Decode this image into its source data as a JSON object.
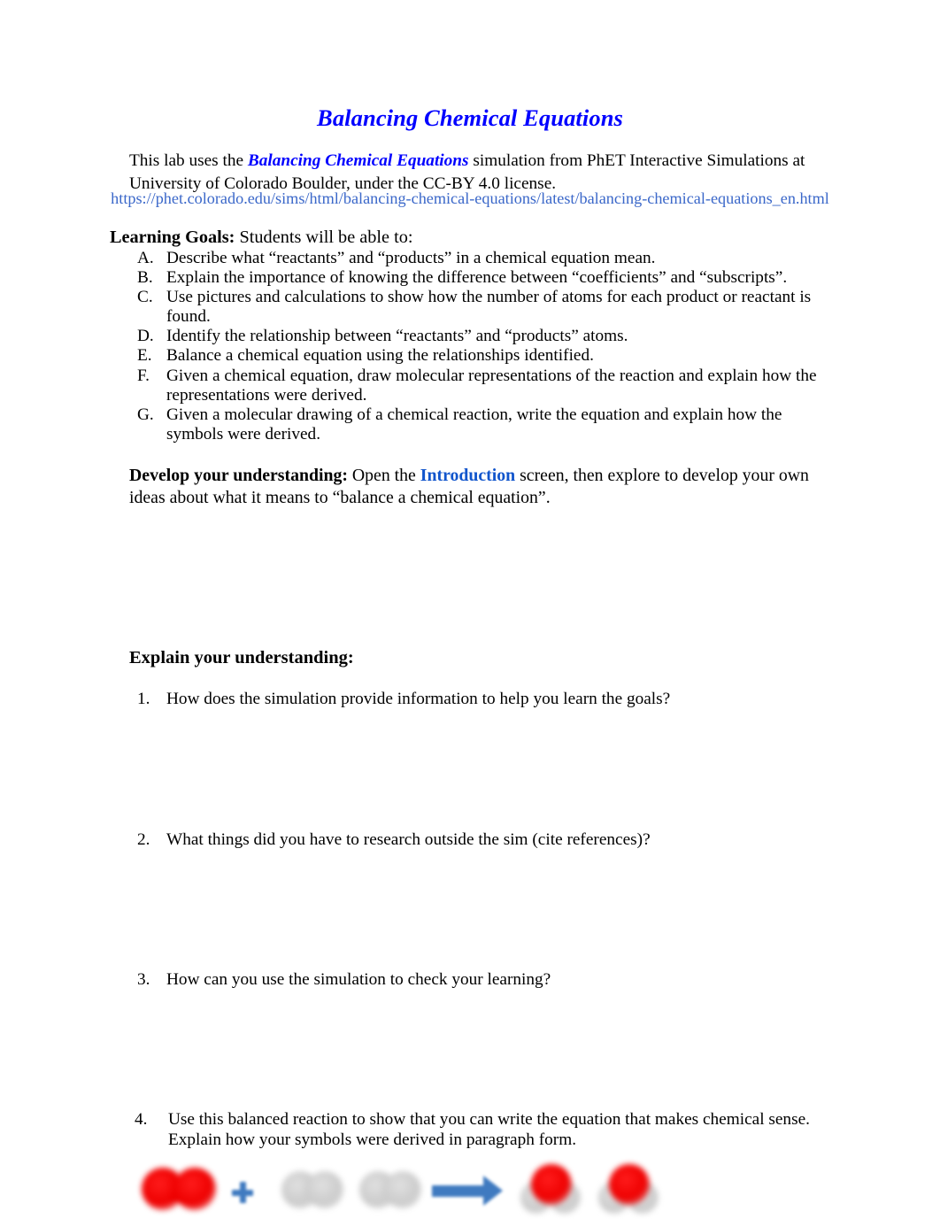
{
  "document": {
    "title": "Balancing Chemical Equations"
  },
  "intro": {
    "text_before": "This lab uses the ",
    "sim_name": "Balancing Chemical Equations",
    "text_after": " simulation from PhET Interactive Simulations at University of Colorado Boulder, under the CC-BY 4.0 license.",
    "url": "https://phet.colorado.edu/sims/html/balancing-chemical-equations/latest/balancing-chemical-equations_en.html"
  },
  "learning_goals": {
    "heading_bold": "Learning Goals:",
    "heading_rest": " Students will be able to:",
    "items": [
      {
        "marker": "A.",
        "text": "Describe what “reactants” and “products” in a chemical equation mean."
      },
      {
        "marker": "B.",
        "text": "Explain the importance of knowing the difference between “coefficients” and “subscripts”."
      },
      {
        "marker": "C.",
        "text": "Use pictures and calculations to show how the number of atoms for each product or reactant is found."
      },
      {
        "marker": "D.",
        "text": "Identify the relationship between “reactants” and “products” atoms."
      },
      {
        "marker": "E.",
        "text": "Balance a chemical equation using the relationships identified."
      },
      {
        "marker": "F.",
        "text": "Given a chemical equation, draw molecular representations of the reaction and explain how the representations were derived."
      },
      {
        "marker": "G.",
        "text": "Given a molecular drawing of a chemical reaction, write the equation and explain how the symbols were derived."
      }
    ]
  },
  "develop": {
    "lead": "Develop your understanding:",
    "text_before": " Open the ",
    "link": "Introduction",
    "text_after": " screen, then explore to develop your own ideas about what it means to “balance a chemical equation”."
  },
  "explain": {
    "heading": "Explain your understanding:",
    "questions": [
      {
        "marker": "1.",
        "text": "How does the simulation provide information to help you learn the goals?"
      },
      {
        "marker": "2.",
        "text": "What things did you have to research outside the sim (cite references)?"
      },
      {
        "marker": "3.",
        "text": "How can you use the simulation to check your learning?"
      },
      {
        "marker": "4.",
        "text": " Use this balanced reaction to show that you can write the equation that makes chemical sense. Explain how your symbols were derived in paragraph form."
      }
    ]
  },
  "reaction_figure": {
    "description": "Molecular drawing of a balanced reaction: one oxygen molecule plus two hydrogen molecules yields two water molecules",
    "reactant_oxygen": "O2-molecule",
    "plus": "+",
    "reactant_hydrogen_1": "H2-molecule",
    "reactant_hydrogen_2": "H2-molecule",
    "arrow": "→",
    "product_water_1": "H2O-molecule",
    "product_water_2": "H2O-molecule"
  },
  "colors": {
    "title_blue": "#0000ff",
    "url_blue": "#3a67c9",
    "link_blue": "#1155cc",
    "oxygen_red": "#ee0000",
    "hydrogen_gray": "#cccccc",
    "symbol_blue": "#3f7ac0",
    "text_black": "#000000",
    "page_background": "#ffffff"
  }
}
